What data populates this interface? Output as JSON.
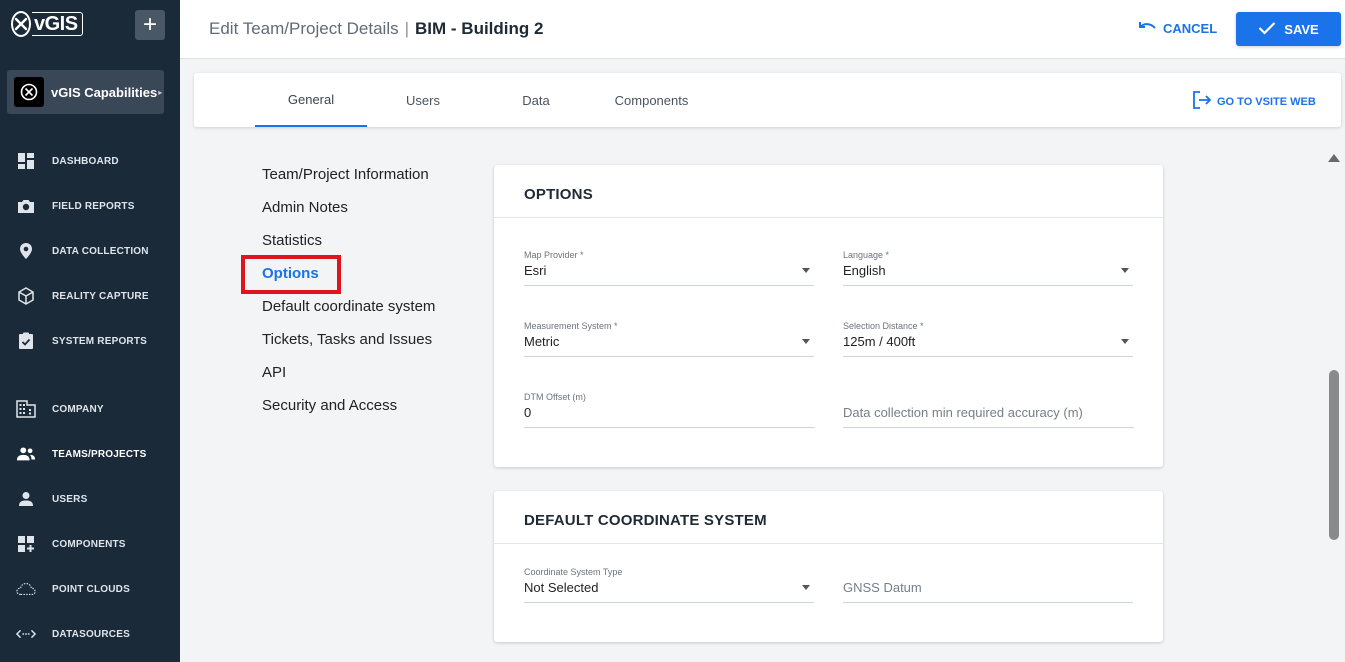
{
  "app": {
    "logo_text": "vGIS",
    "add_label": "+"
  },
  "org": {
    "name": "vGIS Capabilities",
    "caret": "▸"
  },
  "sidebar": {
    "items": [
      {
        "label": "DASHBOARD",
        "icon": "dashboard-icon"
      },
      {
        "label": "FIELD REPORTS",
        "icon": "camera-icon"
      },
      {
        "label": "DATA COLLECTION",
        "icon": "location-pin-icon"
      },
      {
        "label": "REALITY CAPTURE",
        "icon": "cube-icon"
      },
      {
        "label": "SYSTEM REPORTS",
        "icon": "clipboard-icon"
      },
      {
        "label": "COMPANY",
        "icon": "building-icon"
      },
      {
        "label": "TEAMS/PROJECTS",
        "icon": "people-icon",
        "active": true
      },
      {
        "label": "USERS",
        "icon": "person-icon"
      },
      {
        "label": "COMPONENTS",
        "icon": "grid-add-icon"
      },
      {
        "label": "POINT CLOUDS",
        "icon": "cloud-icon"
      },
      {
        "label": "DATASOURCES",
        "icon": "code-arrows-icon"
      }
    ]
  },
  "header": {
    "crumb_prefix": "Edit Team/Project Details",
    "crumb_sep": "|",
    "crumb_name": "BIM - Building 2",
    "cancel_label": "CANCEL",
    "save_label": "SAVE"
  },
  "tabs": [
    {
      "label": "General",
      "active": true
    },
    {
      "label": "Users"
    },
    {
      "label": "Data"
    },
    {
      "label": "Components"
    }
  ],
  "goto_label": "GO TO VSITE WEB",
  "subnav": [
    {
      "label": "Team/Project Information"
    },
    {
      "label": "Admin Notes"
    },
    {
      "label": "Statistics"
    },
    {
      "label": "Options",
      "active": true
    },
    {
      "label": "Default coordinate system"
    },
    {
      "label": "Tickets, Tasks and Issues"
    },
    {
      "label": "API"
    },
    {
      "label": "Security and Access"
    }
  ],
  "options_panel": {
    "title": "OPTIONS",
    "map_provider": {
      "label": "Map Provider *",
      "value": "Esri"
    },
    "language": {
      "label": "Language *",
      "value": "English"
    },
    "measurement": {
      "label": "Measurement System *",
      "value": "Metric"
    },
    "selection_distance": {
      "label": "Selection Distance *",
      "value": "125m / 400ft"
    },
    "dtm_offset": {
      "label": "DTM Offset (m)",
      "value": "0"
    },
    "accuracy": {
      "placeholder": "Data collection min required accuracy (m)"
    }
  },
  "coord_panel": {
    "title": "DEFAULT COORDINATE SYSTEM",
    "type": {
      "label": "Coordinate System Type",
      "value": "Not Selected"
    },
    "gnss": {
      "placeholder": "GNSS Datum"
    }
  },
  "colors": {
    "accent": "#1a73e8",
    "sidebar": "#1b2a38",
    "highlight": "#e0141e"
  }
}
